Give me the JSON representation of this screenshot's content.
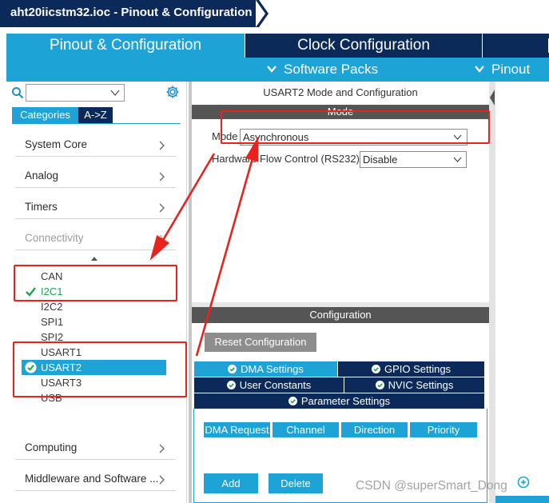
{
  "window": {
    "title": "aht20iicstm32.ioc - Pinout & Configuration"
  },
  "main_tabs": [
    {
      "label": "Pinout & Configuration"
    },
    {
      "label": "Clock Configuration"
    }
  ],
  "subbar": {
    "software_packs": "Software Packs",
    "pinout": "Pinout"
  },
  "sidebar": {
    "search_placeholder": "",
    "view_buttons": {
      "categories": "Categories",
      "az": "A->Z"
    },
    "categories": [
      {
        "label": "System Core"
      },
      {
        "label": "Analog"
      },
      {
        "label": "Timers"
      },
      {
        "label": "Connectivity"
      },
      {
        "label": "Computing"
      },
      {
        "label": "Middleware and Software ..."
      }
    ],
    "connectivity_items": [
      {
        "label": "CAN",
        "state": "none"
      },
      {
        "label": "I2C1",
        "state": "enabled"
      },
      {
        "label": "I2C2",
        "state": "none"
      },
      {
        "label": "SPI1",
        "state": "none"
      },
      {
        "label": "SPI2",
        "state": "none"
      },
      {
        "label": "USART1",
        "state": "none"
      },
      {
        "label": "USART2",
        "state": "selected"
      },
      {
        "label": "USART3",
        "state": "none"
      },
      {
        "label": "USB",
        "state": "none"
      }
    ]
  },
  "mode_panel": {
    "title": "USART2 Mode and Configuration",
    "mode_header": "Mode",
    "mode_label": "Mode",
    "mode_value": "Asynchronous",
    "hfc_label": "Hardware Flow Control (RS232)",
    "hfc_value": "Disable"
  },
  "config_panel": {
    "header": "Configuration",
    "reset_button": "Reset Configuration",
    "tabs": {
      "dma": "DMA Settings",
      "gpio": "GPIO Settings",
      "user_constants": "User Constants",
      "nvic": "NVIC Settings",
      "parameter": "Parameter Settings"
    },
    "dma_columns": [
      "DMA Request",
      "Channel",
      "Direction",
      "Priority"
    ],
    "add_button": "Add",
    "delete_button": "Delete"
  },
  "watermark": "CSDN @superSmart_Dong",
  "colors": {
    "navy": "#0b2a59",
    "accent_blue": "#1ea3d7",
    "header_gray": "#555555",
    "enabled_green": "#1aa652",
    "annotation_red": "#e8231e"
  }
}
